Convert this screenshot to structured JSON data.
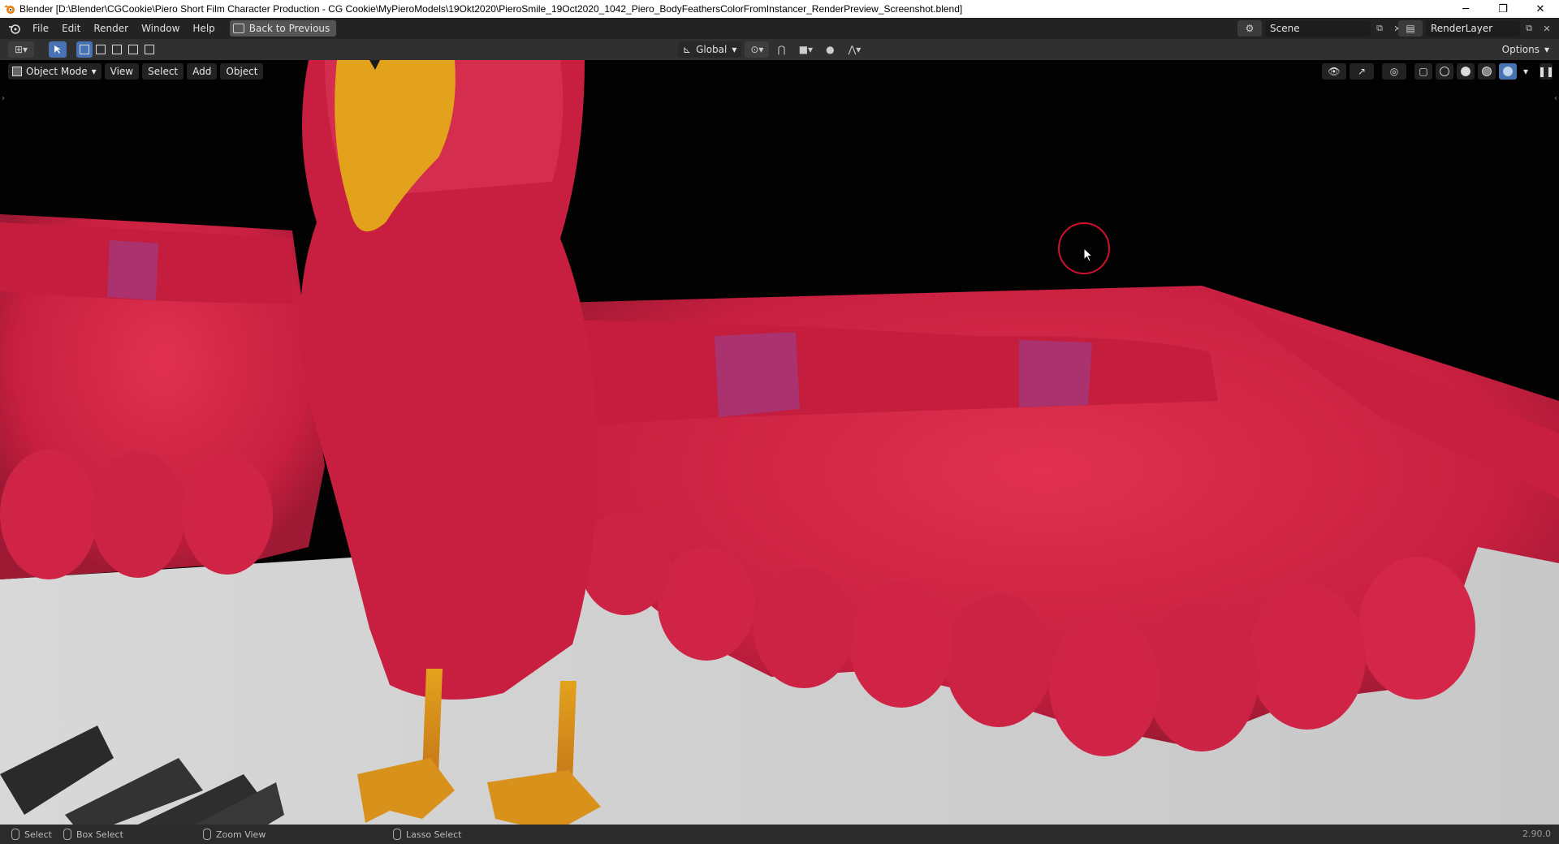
{
  "window": {
    "title": "Blender [D:\\Blender\\CGCookie\\Piero Short Film Character Production - CG Cookie\\MyPieroModels\\19Okt2020\\PieroSmile_19Oct2020_1042_Piero_BodyFeathersColorFromInstancer_RenderPreview_Screenshot.blend]",
    "minimize": "─",
    "restore": "❐",
    "close": "✕"
  },
  "menu": {
    "items": [
      "File",
      "Edit",
      "Render",
      "Window",
      "Help"
    ],
    "back_button": "Back to Previous"
  },
  "scene": {
    "label": "Scene"
  },
  "view_layer": {
    "label": "RenderLayer"
  },
  "tool_header": {
    "orientation": "Global",
    "options": "Options"
  },
  "viewport": {
    "mode": "Object Mode",
    "menus": [
      "View",
      "Select",
      "Add",
      "Object"
    ]
  },
  "status": {
    "items": [
      "Select",
      "Box Select",
      "Zoom View",
      "Lasso Select"
    ],
    "version": "2.90.0"
  },
  "colors": {
    "accent": "#4772b3",
    "feather_red": "#d8244a",
    "cursor_ring": "#d0112b"
  }
}
